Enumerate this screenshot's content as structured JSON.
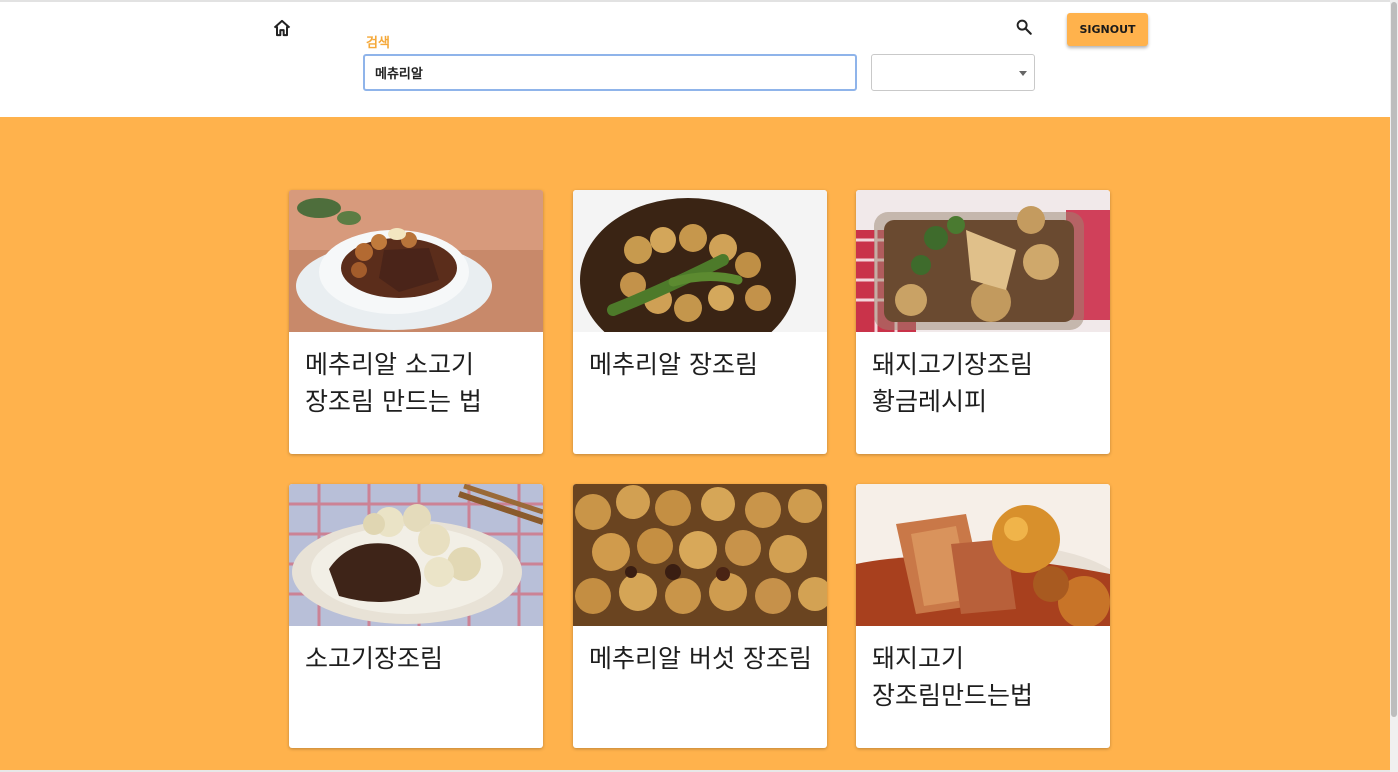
{
  "header": {
    "search_label": "검색",
    "search_value": "메츄리알",
    "select_value": "",
    "signout_label": "SIGNOUT"
  },
  "icons": {
    "home": "home-icon",
    "search": "search-icon",
    "dropdown": "chevron-down-icon"
  },
  "colors": {
    "accent": "#ffb24c",
    "label": "#f5a93a",
    "focus_border": "#8fb4ea"
  },
  "recipes": [
    {
      "title": "메추리알 소고기 장조림 만드는 법"
    },
    {
      "title": "메추리알 장조림"
    },
    {
      "title": "돼지고기장조림 황금레시피"
    },
    {
      "title": "소고기장조림"
    },
    {
      "title": "메추리알 버섯 장조림"
    },
    {
      "title": "돼지고기 장조림만드는법"
    }
  ]
}
